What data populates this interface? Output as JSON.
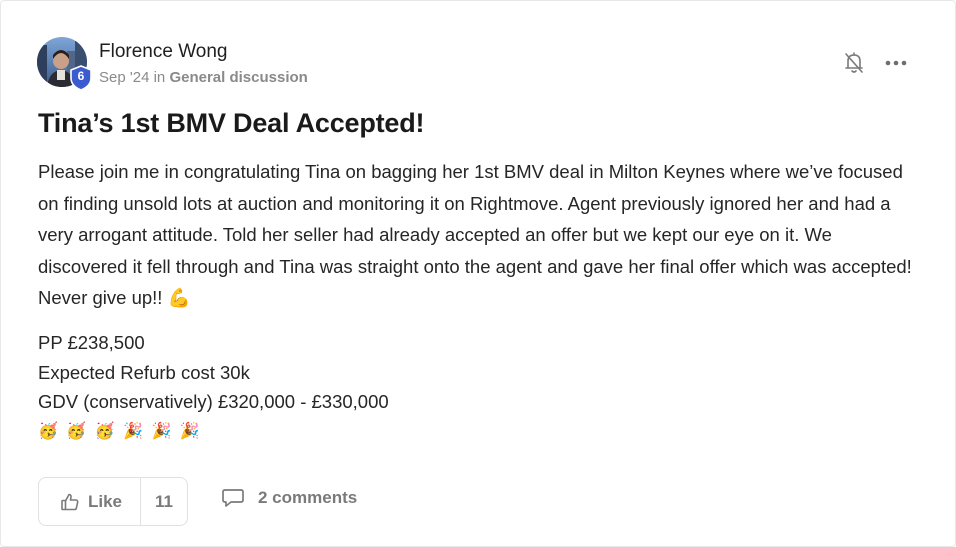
{
  "post": {
    "author": "Florence Wong",
    "level": "6",
    "date": "Sep '24",
    "in_text": "in",
    "category": "General discussion",
    "title": "Tina’s 1st BMV Deal Accepted!",
    "body": "Please join me in congratulating Tina on bagging her 1st BMV deal in Milton Keynes where we’ve focused on finding unsold lots at auction and monitoring it on Rightmove. Agent previously ignored her and had a very arrogant attitude. Told her seller had already accepted an offer but we kept our eye on it. We discovered it fell through and Tina was straight onto the agent and gave her final offer which was accepted! Never give up!! 💪",
    "stats": [
      "PP £238,500",
      "Expected Refurb cost 30k",
      "GDV (conservatively) £320,000 - £330,000"
    ],
    "emojis": "🥳 🥳 🥳 🎉 🎉 🎉"
  },
  "actions": {
    "like_label": "Like",
    "like_count": "11",
    "comments_label": "2 comments"
  },
  "icons": {
    "bell": "bell-off-icon",
    "more": "more-horizontal-icon",
    "like": "thumbs-up-icon",
    "comment": "comment-icon",
    "badge": "shield-badge-icon"
  },
  "colors": {
    "badge": "#3b5bd1",
    "muted": "#7a7a7a"
  }
}
